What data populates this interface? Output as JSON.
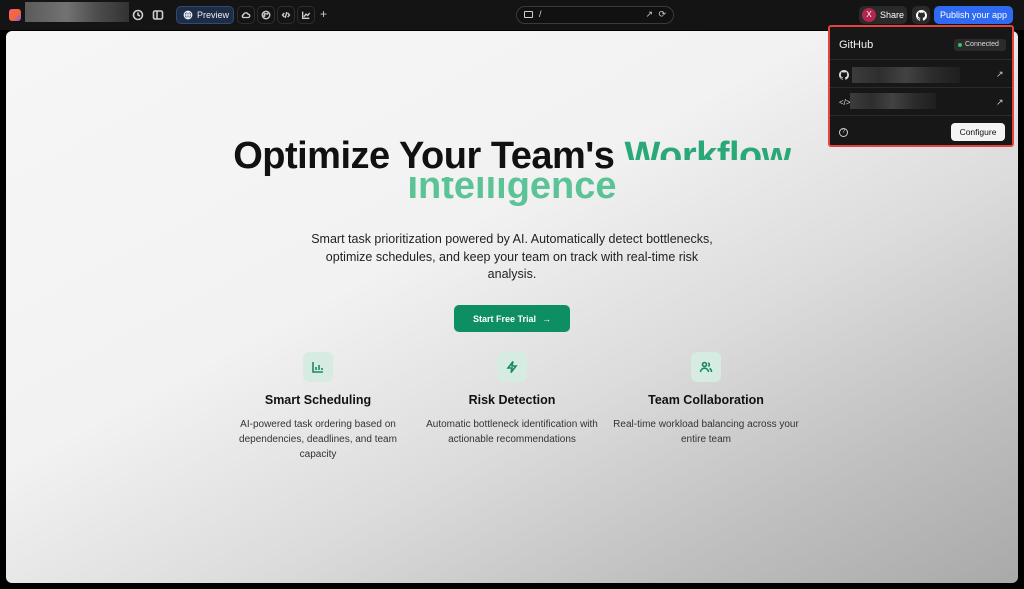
{
  "topbar": {
    "preview_label": "Preview",
    "plus_label": "+",
    "url_path": "/",
    "share_label": "Share",
    "avatar_initial": "X",
    "publish_label": "Publish your app",
    "icons": [
      "history-icon",
      "sidebar-toggle-icon",
      "globe-icon",
      "cloud-icon",
      "palette-icon",
      "code-icon",
      "chart-icon",
      "device-icon",
      "external-link-icon",
      "reload-icon",
      "github-icon"
    ]
  },
  "hero": {
    "title_main": "Optimize Your Team's",
    "title_accent": "Workflow",
    "title_line2": "Intelligence",
    "subtitle": "Smart task prioritization powered by AI. Automatically detect bottlenecks, optimize schedules, and keep your team on track with real-time risk analysis.",
    "cta_label": "Start Free Trial",
    "cta_arrow": "→"
  },
  "features": [
    {
      "title": "Smart Scheduling",
      "desc": "AI-powered task ordering based on dependencies, deadlines, and team capacity",
      "icon": "bar-chart-icon"
    },
    {
      "title": "Risk Detection",
      "desc": "Automatic bottleneck identification with actionable recommendations",
      "icon": "lightning-icon"
    },
    {
      "title": "Team Collaboration",
      "desc": "Real-time workload balancing across your entire team",
      "icon": "users-icon"
    }
  ],
  "github_popover": {
    "title": "GitHub",
    "status": "Connected",
    "code_glyph": "</>",
    "arrow_glyph": "↗",
    "help_glyph": "?",
    "configure_label": "Configure"
  },
  "colors": {
    "accent": "#0e8f63",
    "publish": "#2f6bf2",
    "highlight_border": "#e0463c"
  }
}
